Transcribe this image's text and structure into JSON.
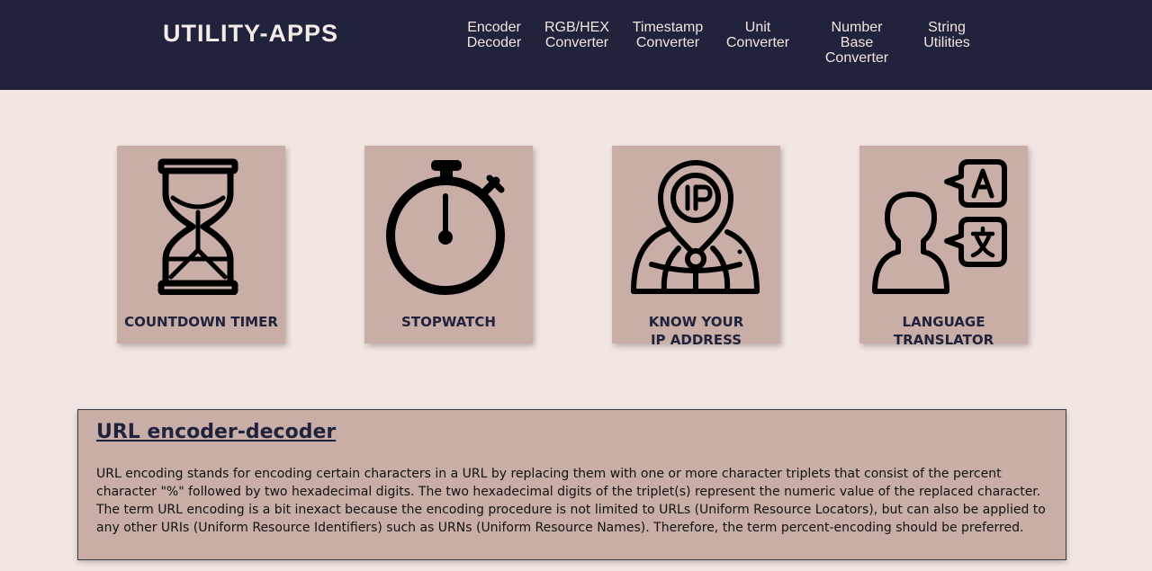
{
  "header": {
    "logo": "UTILITY-APPS",
    "nav": [
      {
        "label": "Encoder\nDecoder"
      },
      {
        "label": "RGB/HEX\nConverter"
      },
      {
        "label": "Timestamp\nConverter"
      },
      {
        "label": "Unit\nConverter"
      },
      {
        "label": "Number Base\nConverter"
      },
      {
        "label": "String\nUtilities"
      }
    ]
  },
  "cards": [
    {
      "label": "COUNTDOWN TIMER",
      "icon": "hourglass-icon"
    },
    {
      "label": "STOPWATCH",
      "icon": "stopwatch-icon"
    },
    {
      "label": "KNOW YOUR IP ADDRESS",
      "icon": "ip-location-icon"
    },
    {
      "label": "LANGUAGE TRANSLATOR",
      "icon": "translator-icon"
    }
  ],
  "info": {
    "title": "URL encoder-decoder",
    "text": "URL encoding stands for encoding certain characters in a URL by replacing them with one or more character triplets that consist of the percent character \"%\" followed by two hexadecimal digits. The two hexadecimal digits of the triplet(s) represent the numeric value of the replaced character. The term URL encoding is a bit inexact because the encoding procedure is not limited to URLs (Uniform Resource Locators), but can also be applied to any other URIs (Uniform Resource Identifiers) such as URNs (Uniform Resource Names). Therefore, the term percent-encoding should be preferred."
  },
  "colors": {
    "header_bg": "#21223c",
    "page_bg": "#f2e6e2",
    "card_bg": "#c8aea7",
    "text_dark": "#21223c"
  }
}
